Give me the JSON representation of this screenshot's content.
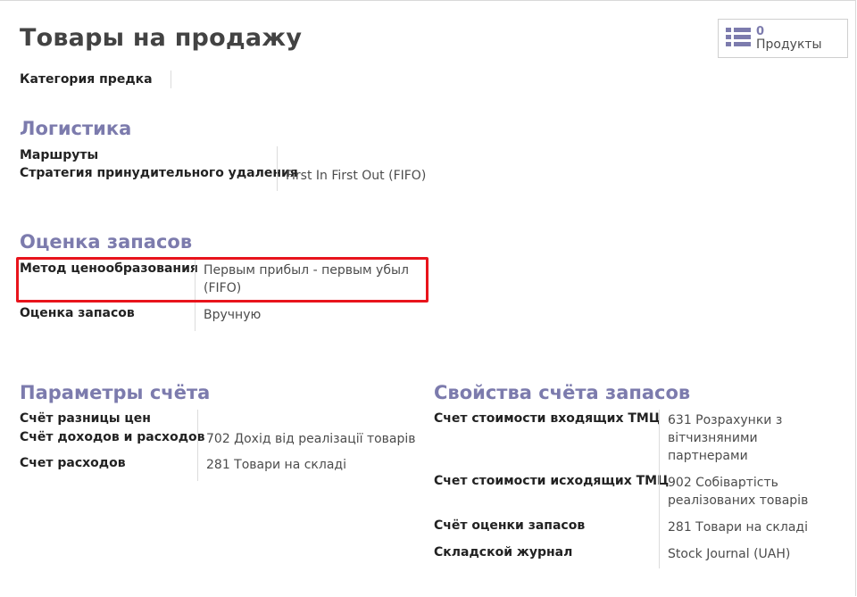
{
  "page": {
    "title": "Товары на продажу",
    "stat": {
      "value": "0",
      "label": "Продукты",
      "icon": "list-icon"
    }
  },
  "general": {
    "parent_category_label": "Категория предка",
    "parent_category_value": ""
  },
  "logistics": {
    "heading": "Логистика",
    "routes_label": "Маршруты",
    "removal_label": "Стратегия принудительного удаления",
    "removal_value": "First In First Out (FIFO)"
  },
  "inventory_valuation": {
    "heading": "Оценка запасов",
    "costing_label": "Метод ценообразования",
    "costing_value": "Первым прибыл - первым убыл (FIFO)",
    "valuation_label": "Оценка запасов",
    "valuation_value": "Вручную",
    "highlight_color": "#e8141c"
  },
  "account_properties": {
    "heading": "Параметры счёта",
    "price_diff_label": "Счёт разницы цен",
    "income_label": "Счёт доходов и расходов",
    "income_value": "702 Дохід від реалізації товарів",
    "expense_label": "Счет расходов",
    "expense_value": "281 Товари на складі"
  },
  "stock_account_properties": {
    "heading": "Свойства счёта запасов",
    "input_label": "Счет стоимости входящих ТМЦ",
    "input_value": "631 Розрахунки з вітчизняними партнерами",
    "output_label": "Счет стоимости исходящих ТМЦ",
    "output_value": "902 Собівартість реалізованих товарів",
    "valuation_label": "Счёт оценки запасов",
    "valuation_value": "281 Товари на складі",
    "journal_label": "Складской журнал",
    "journal_value": "Stock Journal (UAH)"
  },
  "colors": {
    "accent": "#7c7bad",
    "title": "#434343",
    "label": "#222222"
  }
}
